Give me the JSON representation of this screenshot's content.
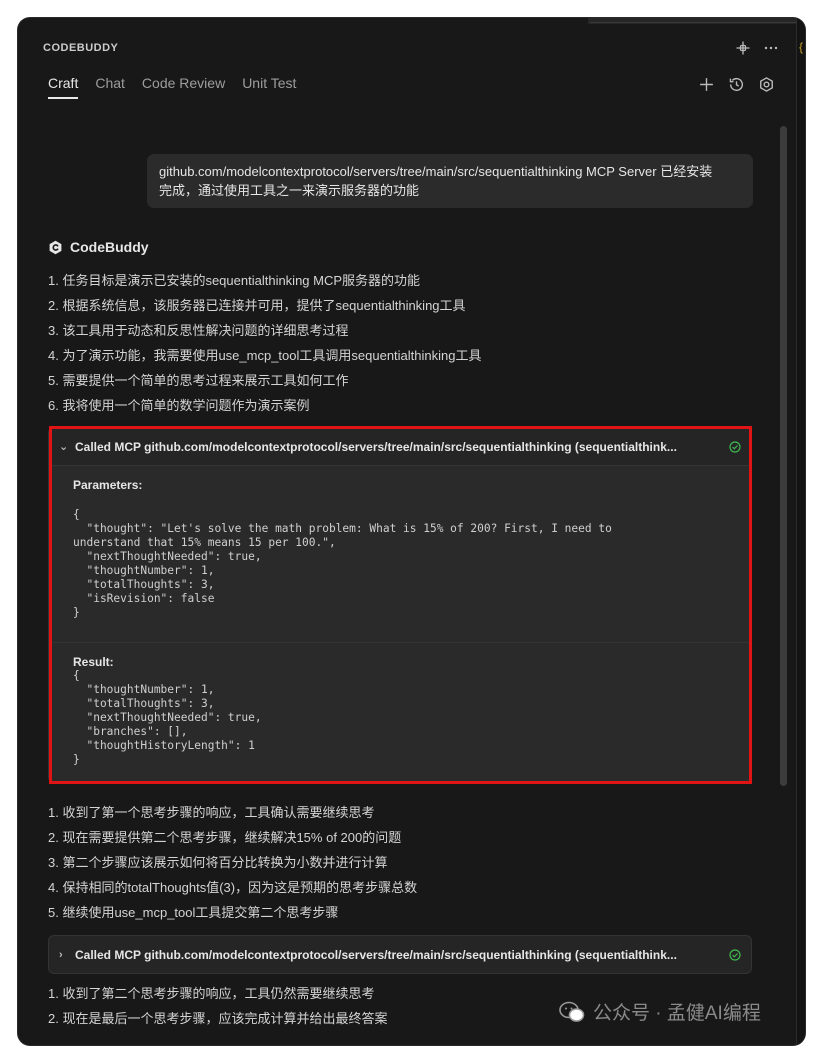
{
  "header": {
    "title": "CODEBUDDY"
  },
  "tabs": [
    {
      "label": "Craft",
      "active": true
    },
    {
      "label": "Chat",
      "active": false
    },
    {
      "label": "Code Review",
      "active": false
    },
    {
      "label": "Unit Test",
      "active": false
    }
  ],
  "user_message": {
    "line1": "github.com/modelcontextprotocol/servers/tree/main/src/sequentialthinking MCP Server 已经安装",
    "line2": "完成，通过使用工具之一来演示服务器的功能"
  },
  "assistant": {
    "name": "CodeBuddy"
  },
  "list1": [
    "1. 任务目标是演示已安装的sequentialthinking MCP服务器的功能",
    "2. 根据系统信息，该服务器已连接并可用，提供了sequentialthinking工具",
    "3. 该工具用于动态和反思性解决问题的详细思考过程",
    "4. 为了演示功能，我需要使用use_mcp_tool工具调用sequentialthinking工具",
    "5. 需要提供一个简单的思考过程来展示工具如何工作",
    "6. 我将使用一个简单的数学问题作为演示案例"
  ],
  "mcp_call_1": {
    "title": "Called MCP github.com/modelcontextprotocol/servers/tree/main/src/sequentialthinking (sequentialthink...",
    "params_label": "Parameters:",
    "params_code": "{\n  \"thought\": \"Let's solve the math problem: What is 15% of 200? First, I need to\nunderstand that 15% means 15 per 100.\",\n  \"nextThoughtNeeded\": true,\n  \"thoughtNumber\": 1,\n  \"totalThoughts\": 3,\n  \"isRevision\": false\n}",
    "result_label": "Result:",
    "result_code": "{\n  \"thoughtNumber\": 1,\n  \"totalThoughts\": 3,\n  \"nextThoughtNeeded\": true,\n  \"branches\": [],\n  \"thoughtHistoryLength\": 1\n}"
  },
  "list2": [
    "1. 收到了第一个思考步骤的响应，工具确认需要继续思考",
    "2. 现在需要提供第二个思考步骤，继续解决15% of 200的问题",
    "3. 第二个步骤应该展示如何将百分比转换为小数并进行计算",
    "4. 保持相同的totalThoughts值(3)，因为这是预期的思考步骤总数",
    "5. 继续使用use_mcp_tool工具提交第二个思考步骤"
  ],
  "mcp_call_2": {
    "title": "Called MCP github.com/modelcontextprotocol/servers/tree/main/src/sequentialthinking (sequentialthink..."
  },
  "list3": [
    "1. 收到了第二个思考步骤的响应，工具仍然需要继续思考",
    "2. 现在是最后一个思考步骤，应该完成计算并给出最终答案"
  ],
  "watermark": {
    "text": "公众号 · 孟健AI编程"
  },
  "colors": {
    "background": "#181818",
    "highlight": "#e01414",
    "success": "#3fb950"
  }
}
